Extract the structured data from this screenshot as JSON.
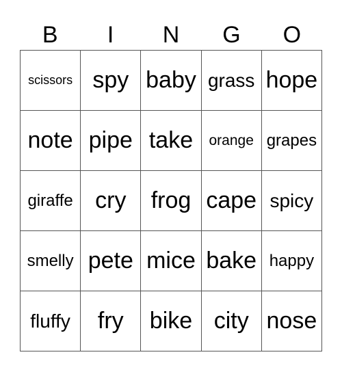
{
  "header": {
    "letters": [
      "B",
      "I",
      "N",
      "G",
      "O"
    ]
  },
  "board": {
    "rows": [
      [
        "scissors",
        "spy",
        "baby",
        "grass",
        "hope"
      ],
      [
        "note",
        "pipe",
        "take",
        "orange",
        "grapes"
      ],
      [
        "giraffe",
        "cry",
        "frog",
        "cape",
        "spicy"
      ],
      [
        "smelly",
        "pete",
        "mice",
        "bake",
        "happy"
      ],
      [
        "fluffy",
        "fry",
        "bike",
        "city",
        "nose"
      ]
    ]
  }
}
